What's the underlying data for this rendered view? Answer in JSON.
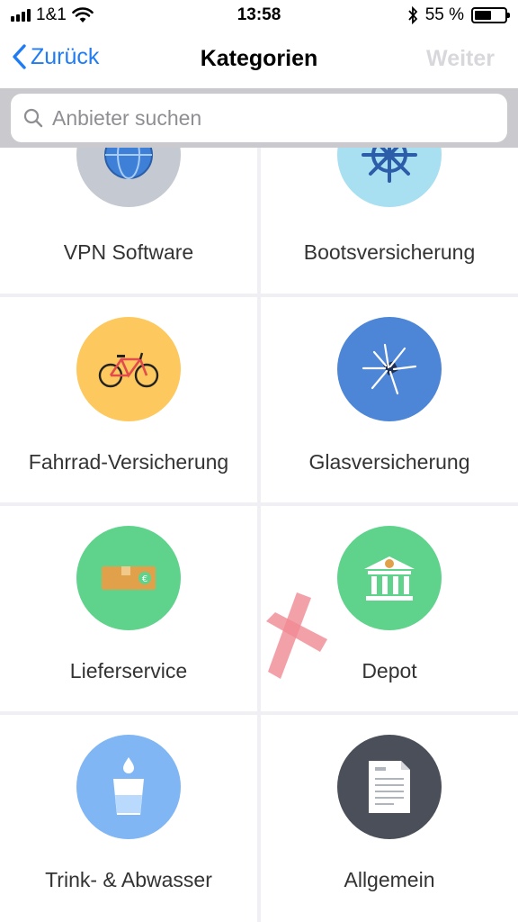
{
  "status_bar": {
    "carrier": "1&1",
    "time": "13:58",
    "battery": "55 %",
    "battery_level": 0.55
  },
  "nav": {
    "back_label": "Zurück",
    "title": "Kategorien",
    "next_label": "Weiter"
  },
  "search": {
    "placeholder": "Anbieter suchen",
    "value": ""
  },
  "categories": [
    {
      "label": "VPN Software",
      "icon": "globe-icon",
      "color": "#c5c9d1"
    },
    {
      "label": "Bootsversicherung",
      "icon": "ship-wheel-icon",
      "color": "#a8dff1"
    },
    {
      "label": "Fahrrad-Versicherung",
      "icon": "bicycle-icon",
      "color": "#fdc85e"
    },
    {
      "label": "Glasversicherung",
      "icon": "broken-glass-icon",
      "color": "#4d86d6"
    },
    {
      "label": "Lieferservice",
      "icon": "package-icon",
      "color": "#5fd38c"
    },
    {
      "label": "Depot",
      "icon": "bank-icon",
      "color": "#5fd38c"
    },
    {
      "label": "Trink- & Abwasser",
      "icon": "water-glass-icon",
      "color": "#7fb6f3"
    },
    {
      "label": "Allgemein",
      "icon": "document-icon",
      "color": "#4a4f5a"
    }
  ]
}
